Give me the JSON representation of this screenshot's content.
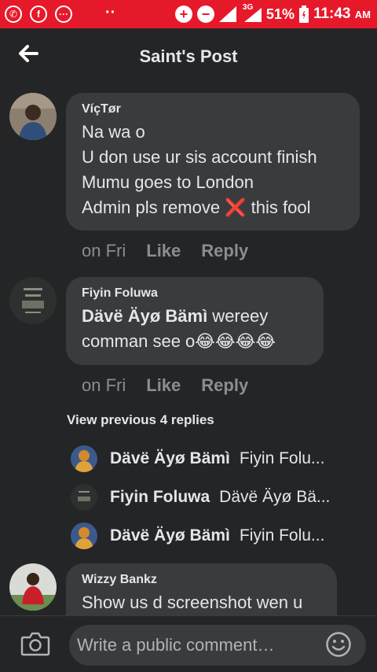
{
  "statusbar": {
    "battery": "51%",
    "time": "11:43",
    "ampm": "AM",
    "network": "3G",
    "icons": [
      "whatsapp-icon",
      "facebook-icon",
      "messenger-icon",
      "dots-icon",
      "data-saver-icon",
      "dnd-icon",
      "signal-icon",
      "battery-icon"
    ]
  },
  "header": {
    "title": "Saint's Post"
  },
  "comments": [
    {
      "name": "VíçTør",
      "text": "Na wa o\nU don use ur sis account finish\nMumu goes to London\nAdmin pls remove ❌ this fool",
      "time": "on Fri",
      "like": "Like",
      "reply": "Reply"
    },
    {
      "name": "Fiyin Foluwa",
      "mention": "Dävë Äyø Bämì",
      "text": " wereey comman see o😂😂😂😂",
      "time": "on Fri",
      "like": "Like",
      "reply": "Reply"
    },
    {
      "name": "Wizzy Bankz",
      "text": "Show us d screenshot wen u"
    }
  ],
  "view_previous": "View previous 4 replies",
  "replies": [
    {
      "name": "Dävë Äyø Bämì",
      "preview": "Fiyin Folu..."
    },
    {
      "name": "Fiyin Foluwa",
      "preview": "Dävë Äyø Bä..."
    },
    {
      "name": "Dävë Äyø Bämì",
      "preview": "Fiyin Folu..."
    }
  ],
  "composer": {
    "placeholder": "Write a public comment…"
  },
  "colors": {
    "statusbar": "#e6192a",
    "background": "#242526",
    "bubble": "#3a3b3c",
    "muted": "#8a8d91"
  }
}
